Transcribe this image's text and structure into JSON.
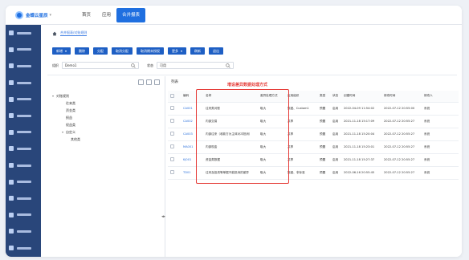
{
  "brand": {
    "name": "金蝶云星辰"
  },
  "topnav": [
    {
      "label": "首页"
    },
    {
      "label": "应用"
    },
    {
      "label": "合并报表"
    }
  ],
  "sidebar_count": 14,
  "breadcrumb": "合并报表/对账规则",
  "toolbar": {
    "buttons": [
      "新增",
      "删除",
      "分配",
      "取消分配",
      "取消期末授权",
      "更多",
      "刷新",
      "退出"
    ],
    "dropdown_buttons": [
      0,
      5
    ]
  },
  "filters": {
    "org_label": "组织",
    "org_value": "Demo1",
    "status_label": "状态",
    "status_value": "可用"
  },
  "tree": [
    {
      "label": "对账规则",
      "level": 0,
      "caret": "▾"
    },
    {
      "label": "往来类",
      "level": 1
    },
    {
      "label": "资金类",
      "level": 1
    },
    {
      "label": "损益",
      "level": 1
    },
    {
      "label": "权益类",
      "level": 1
    },
    {
      "label": "自定义",
      "level": 1,
      "caret": "▾"
    },
    {
      "label": "其他类",
      "level": 2
    }
  ],
  "table": {
    "title": "列表",
    "annotation": "增设差异数据处理方式",
    "columns": [
      "",
      "编码",
      "名称",
      "差异处理方式",
      "应用组织",
      "类型",
      "状态",
      "创建时间",
      "修改时间",
      "修改人"
    ],
    "rows": [
      [
        "",
        "CA001",
        "往来类对账",
        "取大",
        "集团、Custom1",
        "预置",
        "启用",
        "2022-04-09 11:54:02",
        "2022-07-12 20:55:00",
        "系统"
      ],
      [
        "",
        "CA002",
        "内部交易",
        "取大",
        "共享",
        "预置",
        "启用",
        "2021-11-18 15:17:09",
        "2022-07-12 20:55:27",
        "系统"
      ],
      [
        "",
        "CA003",
        "内部往来（收款方为主体对冲抵消）",
        "取大",
        "共享",
        "预置",
        "启用",
        "2021-11-18 15:20:04",
        "2022-07-12 20:55:27",
        "系统"
      ],
      [
        "",
        "MA001",
        "内部现金",
        "取大",
        "共享",
        "预置",
        "启用",
        "2021-11-18 15:23:01",
        "2022-07-12 20:55:27",
        "系统"
      ],
      [
        "",
        "KJ001",
        "资金类数据",
        "取大",
        "共享",
        "预置",
        "启用",
        "2021-11-18 15:27:37",
        "2022-07-12 20:55:27",
        "系统"
      ],
      [
        "",
        "TD01",
        "往来及投资等单据不能抵消的差异",
        "取大",
        "集团、非标准",
        "预置",
        "启用",
        "2022-06-16 20:55:45",
        "2022-07-12 20:55:27",
        "系统"
      ]
    ]
  },
  "colors": {
    "primary": "#1f6fe0",
    "sidebar": "#29467a",
    "annotation": "#e53935"
  }
}
